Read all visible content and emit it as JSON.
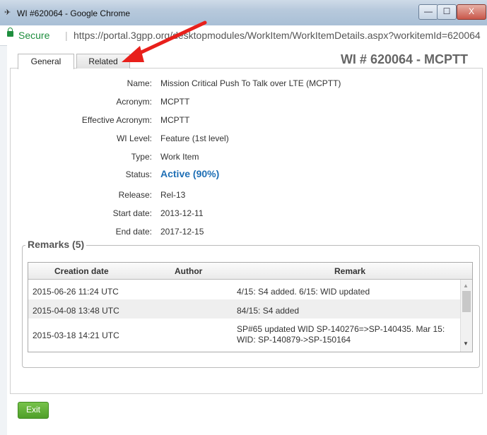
{
  "window": {
    "title": "WI #620064 - Google Chrome",
    "min": "—",
    "max": "☐",
    "close": "X"
  },
  "address": {
    "secure_label": "Secure",
    "url": "https://portal.3gpp.org/desktopmodules/WorkItem/WorkItemDetails.aspx?workitemId=620064"
  },
  "tabs": [
    {
      "label": "General"
    },
    {
      "label": "Related"
    }
  ],
  "header": {
    "wi_title": "WI # 620064 - MCPTT"
  },
  "fields": [
    {
      "label": "Name:",
      "value": "Mission Critical Push To Talk over LTE (MCPTT)"
    },
    {
      "label": "Acronym:",
      "value": "MCPTT"
    },
    {
      "label": "Effective Acronym:",
      "value": "MCPTT"
    },
    {
      "label": "WI Level:",
      "value": "Feature (1st level)"
    },
    {
      "label": "Type:",
      "value": "Work Item"
    },
    {
      "label": "Status:",
      "value": "Active (90%)"
    },
    {
      "label": "Release:",
      "value": "Rel-13"
    },
    {
      "label": "Start date:",
      "value": "2013-12-11"
    },
    {
      "label": "End date:",
      "value": "2017-12-15"
    }
  ],
  "remarks": {
    "legend": "Remarks (5)",
    "columns": [
      "Creation date",
      "Author",
      "Remark"
    ],
    "rows": [
      {
        "date": "2015-06-26 11:24 UTC",
        "author": "",
        "remark": "4/15: S4 added. 6/15: WID updated"
      },
      {
        "date": "2015-04-08 13:48 UTC",
        "author": "",
        "remark": "84/15: S4 added"
      },
      {
        "date": "2015-03-18 14:21 UTC",
        "author": "",
        "remark": "SP#65 updated WID SP-140276=>SP-140435. Mar 15: WID: SP-140879->SP-150164"
      }
    ]
  },
  "footer": {
    "exit_label": "Exit"
  },
  "colors": {
    "status_active": "#1f6fb5",
    "exit_button": "#5aae33",
    "annotation_arrow": "#e8201b"
  }
}
